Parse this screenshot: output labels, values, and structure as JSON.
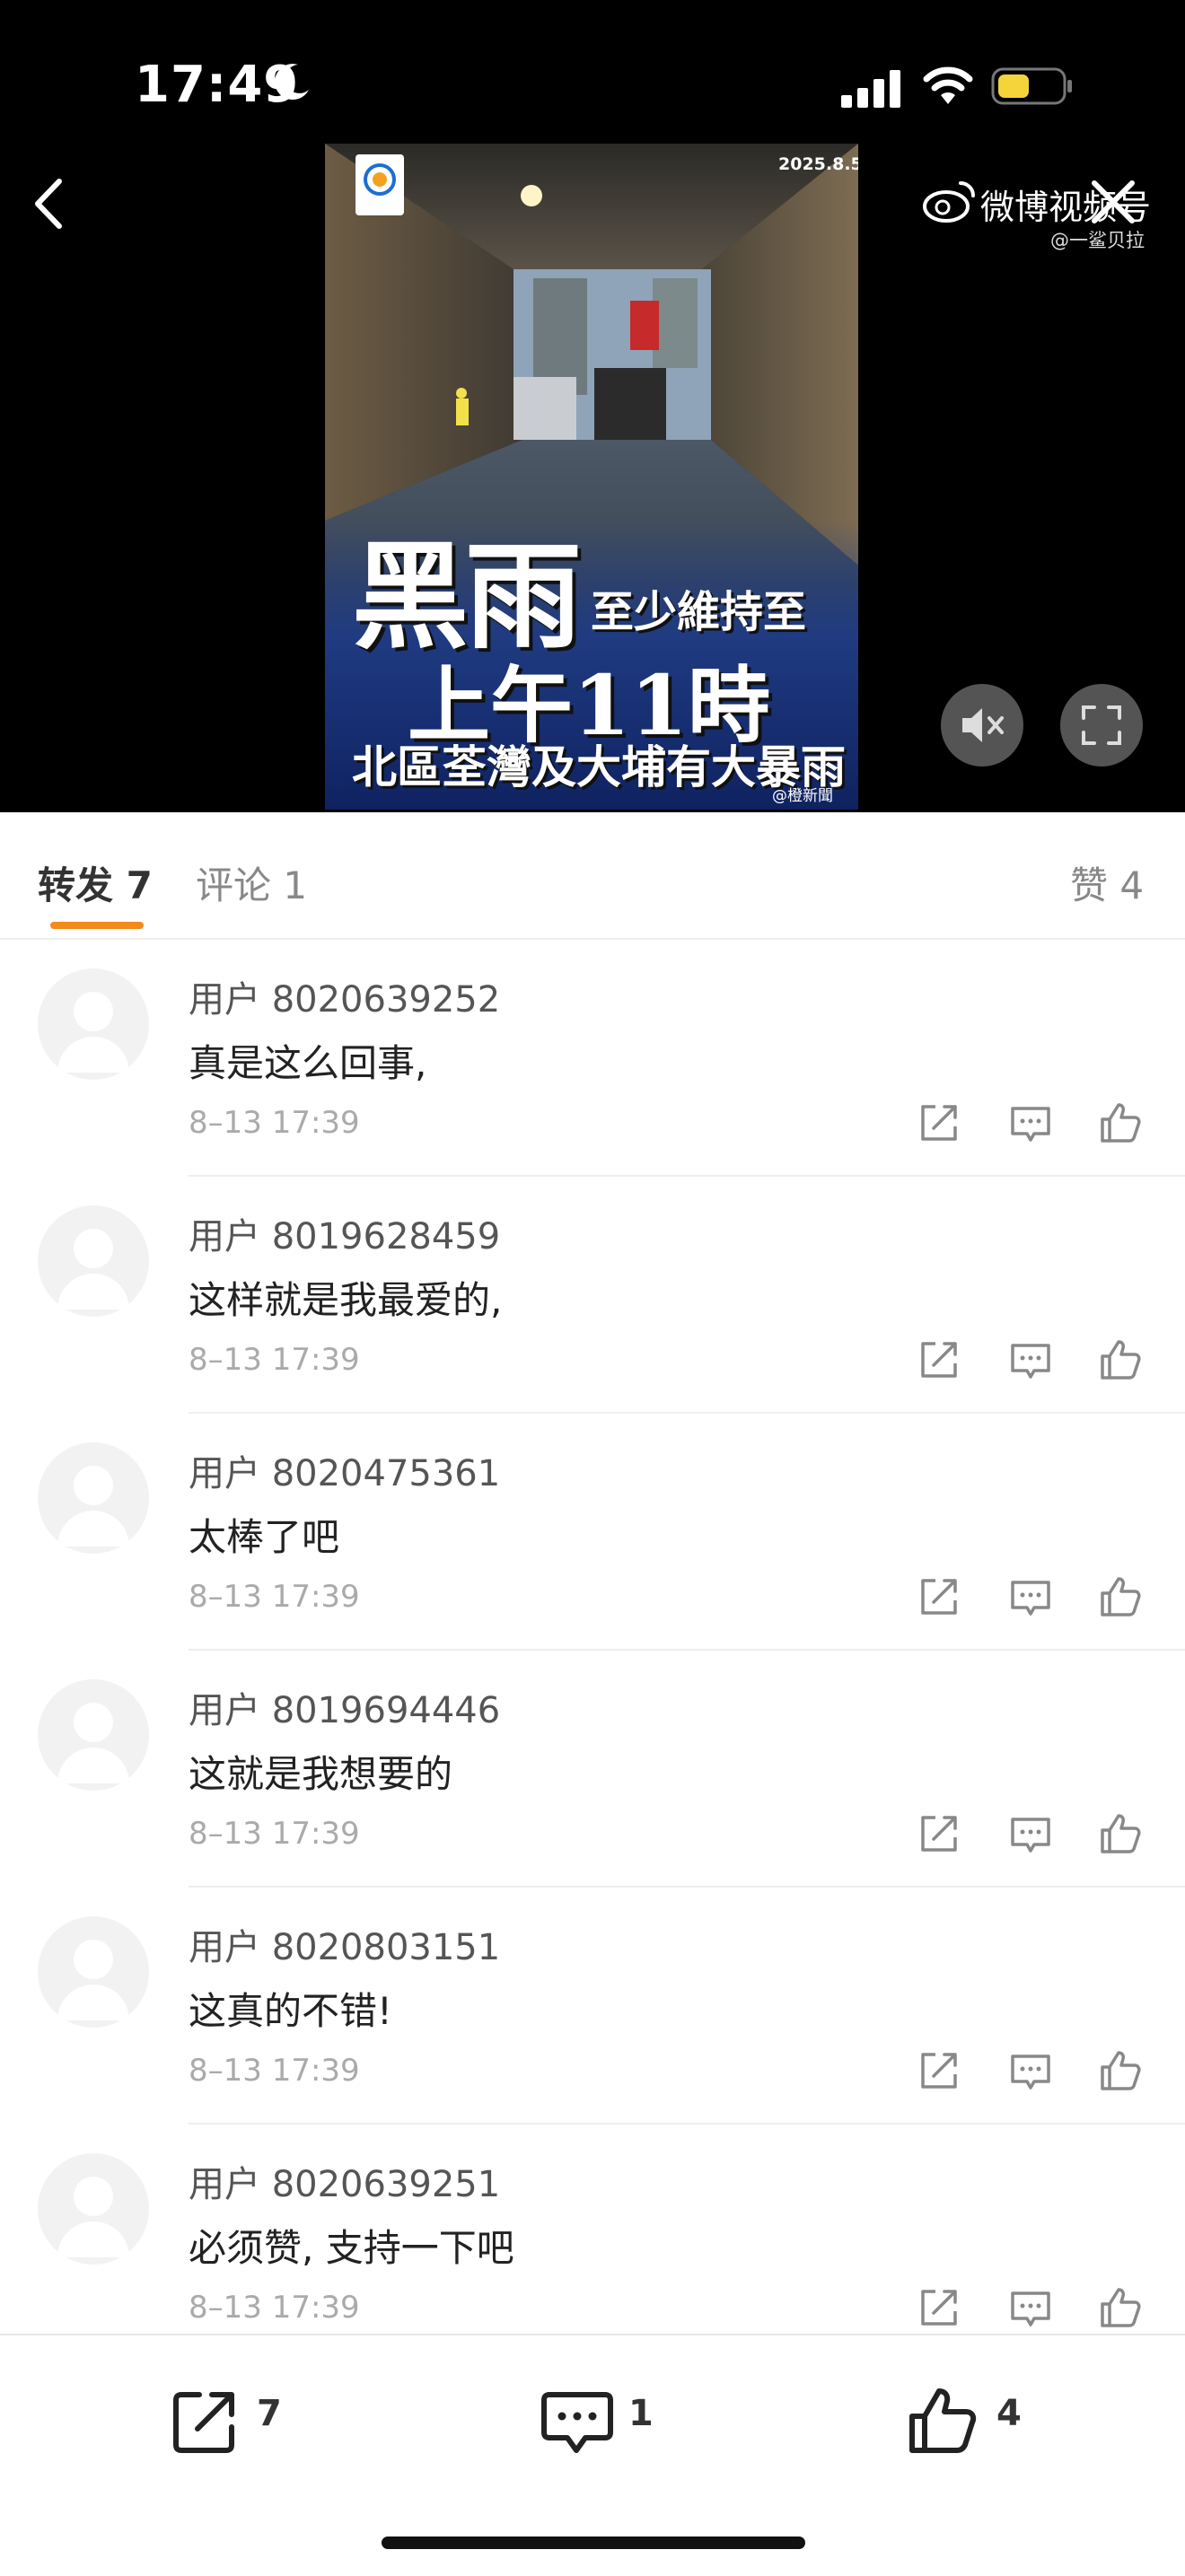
{
  "status_bar": {
    "time": "17:49"
  },
  "video": {
    "watermark_title": "微博视频号",
    "watermark_sub": "@一鲨贝拉",
    "thumb_date": "2025.8.5",
    "headline_big": "黑雨",
    "headline_small": "至少維持至",
    "headline_time": "上午11時",
    "headline_sub": "北區荃灣及大埔有大暴雨",
    "source_tag": "@橙新聞"
  },
  "tabs": {
    "repost": "转发 7",
    "comment": "评论 1",
    "like": "赞 4"
  },
  "comments": [
    {
      "user": "用户 8020639252",
      "text": "真是这么回事,",
      "time": "8–13 17:39"
    },
    {
      "user": "用户 8019628459",
      "text": "这样就是我最爱的,",
      "time": "8–13 17:39"
    },
    {
      "user": "用户 8020475361",
      "text": "太棒了吧",
      "time": "8–13 17:39"
    },
    {
      "user": "用户 8019694446",
      "text": "这就是我想要的",
      "time": "8–13 17:39"
    },
    {
      "user": "用户 8020803151",
      "text": "这真的不错!",
      "time": "8–13 17:39"
    },
    {
      "user": "用户 8020639251",
      "text": "必须赞, 支持一下吧",
      "time": "8–13 17:39"
    }
  ],
  "bottom_bar": {
    "share_count": "7",
    "comment_count": "1",
    "like_count": "4"
  },
  "colors": {
    "accent": "#f48a1a"
  },
  "icons": [
    "moon-icon",
    "signal-icon",
    "wifi-icon",
    "battery-icon",
    "back-icon",
    "close-icon",
    "weibo-logo-icon",
    "mute-icon",
    "fullscreen-icon",
    "share-icon",
    "comment-icon",
    "like-icon"
  ]
}
